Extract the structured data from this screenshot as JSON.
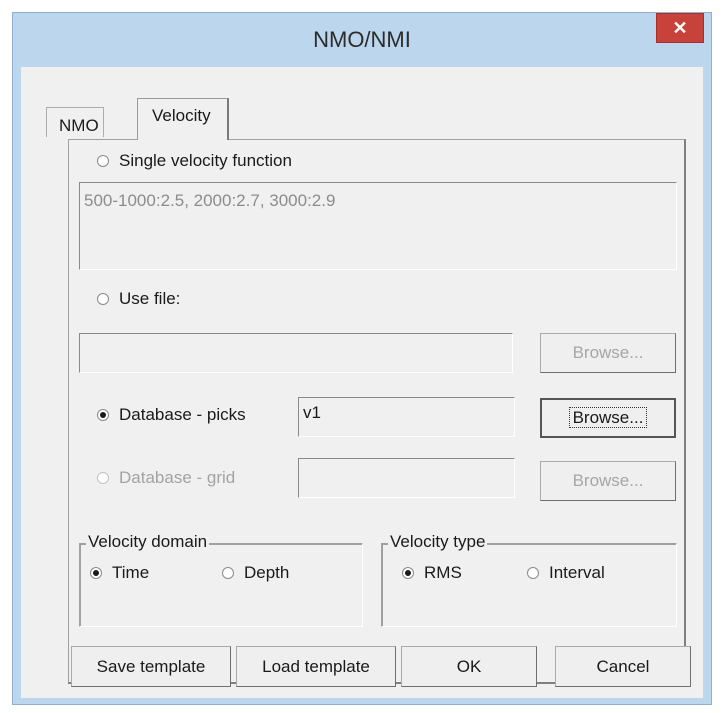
{
  "window": {
    "title": "NMO/NMI",
    "close_glyph": "✕"
  },
  "tabs": [
    {
      "label": "NMO"
    },
    {
      "label": "Velocity"
    }
  ],
  "velocity": {
    "single": {
      "label": "Single velocity function",
      "value": "500-1000:2.5, 2000:2.7, 3000:2.9"
    },
    "use_file": {
      "label": "Use file:",
      "value": "",
      "browse": "Browse..."
    },
    "db_picks": {
      "label": "Database - picks",
      "value": "v1",
      "browse": "Browse..."
    },
    "db_grid": {
      "label": "Database - grid",
      "value": "",
      "browse": "Browse..."
    },
    "domain": {
      "label": "Velocity domain",
      "options": [
        "Time",
        "Depth"
      ],
      "selected": "Time"
    },
    "type": {
      "label": "Velocity type",
      "options": [
        "RMS",
        "Interval"
      ],
      "selected": "RMS"
    }
  },
  "footer": {
    "save_template": "Save template",
    "load_template": "Load template",
    "ok": "OK",
    "cancel": "Cancel"
  }
}
